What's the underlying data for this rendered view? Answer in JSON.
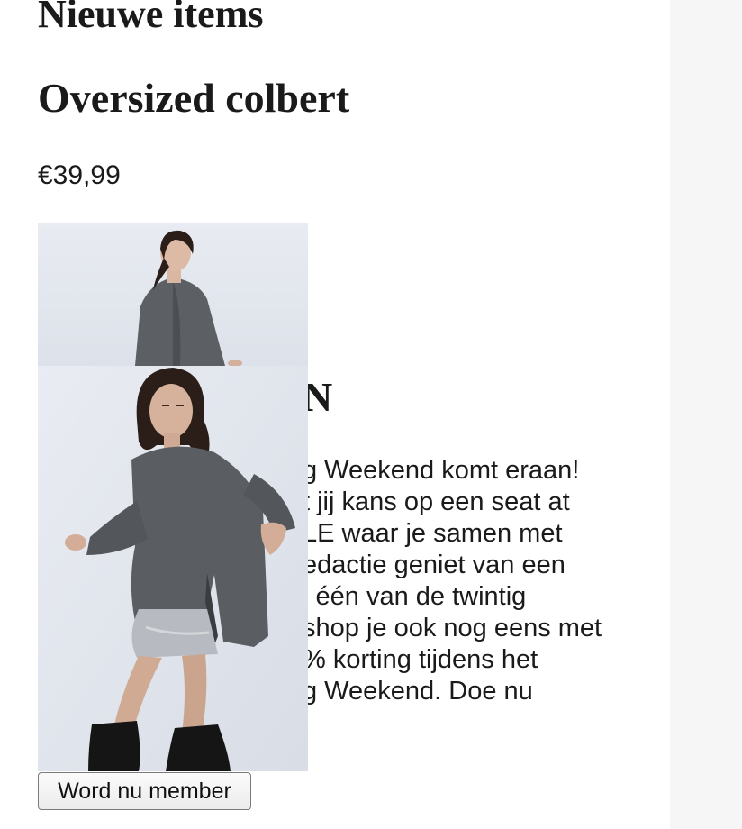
{
  "section": {
    "title": "Nieuwe items"
  },
  "product": {
    "title": "Oversized colbert",
    "price": "€39,99"
  },
  "promo": {
    "heading_visible": "N",
    "lines": [
      "g Weekend komt eraan!",
      "t jij kans op een seat at",
      "LE waar je samen met",
      "edactie geniet van een",
      "j één van de twintig",
      "shop je ook nog eens met",
      "% korting tijdens het",
      "g Weekend. Doe nu"
    ]
  },
  "images": {
    "small_alt": "model-grey-oversized-blazer",
    "large_alt": "model-grey-knit-sweater-silver-skirt-black-boots"
  },
  "cta": {
    "label": "Word nu member"
  },
  "colors": {
    "text": "#1a1a1a",
    "right_panel": "#f6f6f7",
    "photo_background": "#e4e8f0",
    "sweater": "#5a5d62",
    "skirt": "#b9bcc2",
    "boots": "#151515",
    "hair": "#2b1d18"
  }
}
